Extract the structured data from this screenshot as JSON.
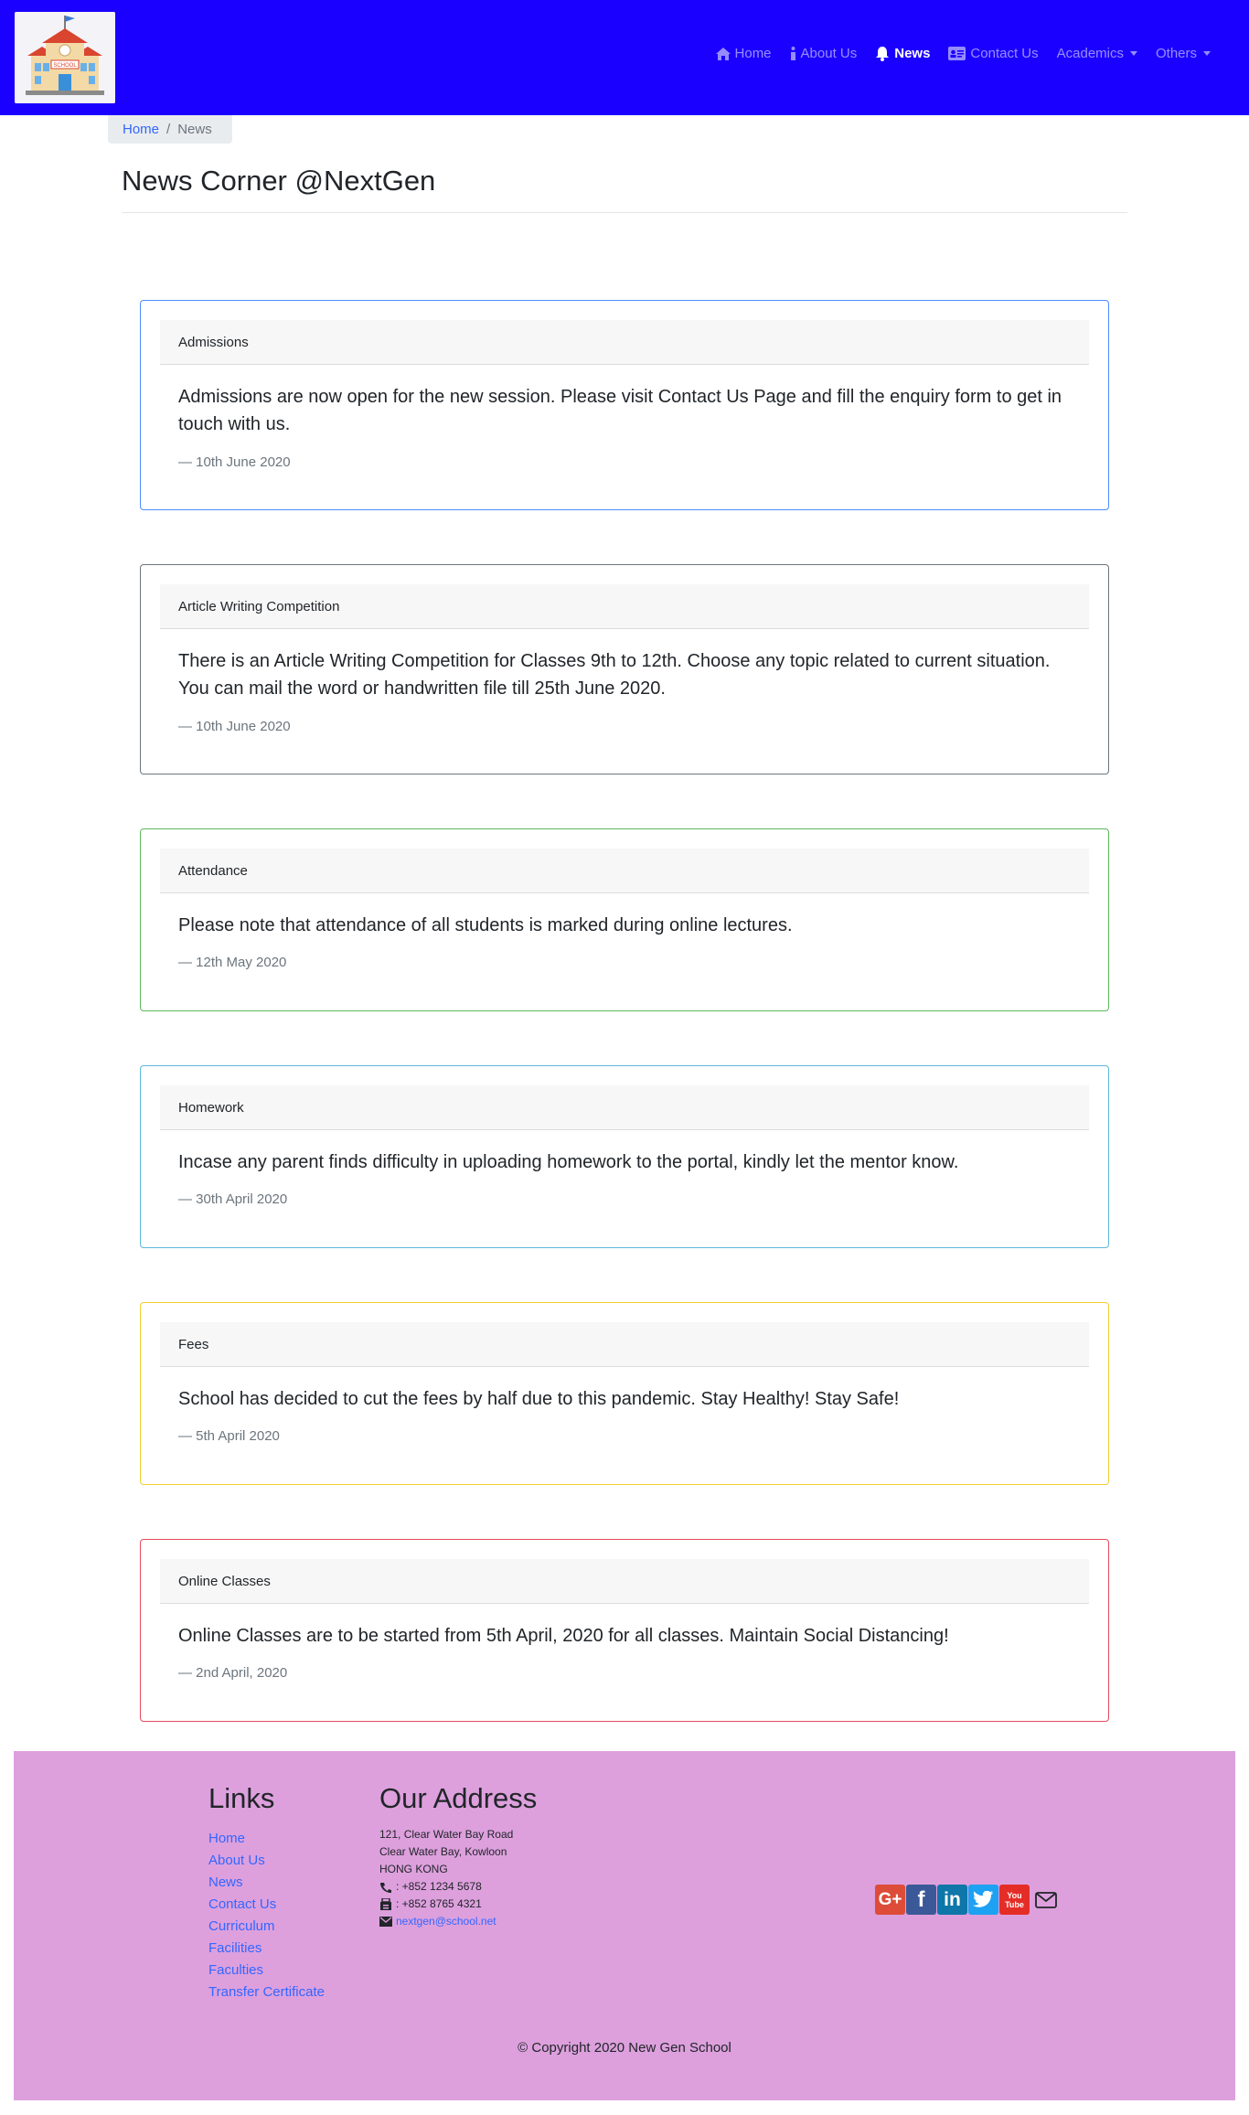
{
  "navbar": {
    "logo_text": "SCHOOL",
    "items": [
      {
        "label": "Home",
        "icon": "home-icon"
      },
      {
        "label": "About Us",
        "icon": "info-icon"
      },
      {
        "label": "News",
        "icon": "bell-icon",
        "active": true
      },
      {
        "label": "Contact Us",
        "icon": "address-card-icon"
      },
      {
        "label": "Academics",
        "dropdown": true
      },
      {
        "label": "Others",
        "dropdown": true
      }
    ],
    "background": "#1a00ff"
  },
  "breadcrumb": {
    "home": "Home",
    "separator": "/",
    "current": "News"
  },
  "page": {
    "title": "News Corner @NextGen"
  },
  "news": [
    {
      "title": "Admissions",
      "text": "Admissions are now open for the new session. Please visit Contact Us Page and fill the enquiry form to get in touch with us.",
      "date": "— 10th June 2020",
      "border_color": "#4d8cff"
    },
    {
      "title": "Article Writing Competition",
      "text": "There is an Article Writing Competition for Classes 9th to 12th. Choose any topic related to current situation. You can mail the word or handwritten file till 25th June 2020.",
      "date": "— 10th June 2020",
      "border_color": "#6c757d"
    },
    {
      "title": "Attendance",
      "text": "Please note that attendance of all students is marked during online lectures.",
      "date": "— 12th May 2020",
      "border_color": "#5cb85c"
    },
    {
      "title": "Homework",
      "text": "Incase any parent finds difficulty in uploading homework to the portal, kindly let the mentor know.",
      "date": "— 30th April 2020",
      "border_color": "#5bb8d9"
    },
    {
      "title": "Fees",
      "text": "School has decided to cut the fees by half due to this pandemic. Stay Healthy! Stay Safe!",
      "date": "— 5th April 2020",
      "border_color": "#f0d030"
    },
    {
      "title": "Online Classes",
      "text": "Online Classes are to be started from 5th April, 2020 for all classes. Maintain Social Distancing!",
      "date": "— 2nd April, 2020",
      "border_color": "#e84a5f"
    }
  ],
  "footer": {
    "links_heading": "Links",
    "links": [
      "Home",
      "About Us",
      "News",
      "Contact Us",
      "Curriculum",
      "Facilities",
      "Faculties",
      "Transfer Certificate"
    ],
    "address_heading": "Our Address",
    "address_lines": [
      "121, Clear Water Bay Road",
      "Clear Water Bay, Kowloon",
      "HONG KONG"
    ],
    "phone": ": +852 1234 5678",
    "fax": ": +852 8765 4321",
    "email": "nextgen@school.net",
    "social": [
      {
        "label": "G+",
        "icon": "google-plus-icon",
        "color": "#dd4b39"
      },
      {
        "label": "f",
        "icon": "facebook-icon",
        "color": "#3b5998"
      },
      {
        "label": "in",
        "icon": "linkedin-icon",
        "color": "#0e76a8"
      },
      {
        "label": "",
        "icon": "twitter-icon",
        "color": "#1da1f2"
      },
      {
        "label": "You Tube",
        "icon": "youtube-icon",
        "color": "#e52d27"
      },
      {
        "label": "",
        "icon": "envelope-icon",
        "color": "#212529"
      }
    ],
    "copyright": "© Copyright 2020 New Gen School",
    "background": "#dda0dd"
  }
}
